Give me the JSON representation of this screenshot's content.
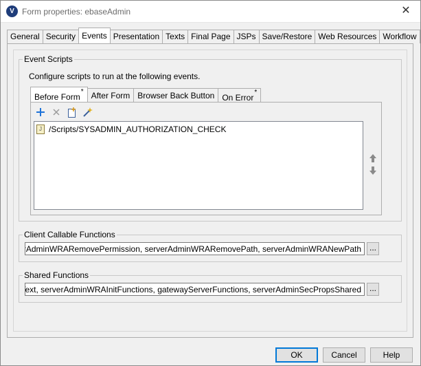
{
  "window": {
    "title": "Form properties: ebaseAdmin",
    "app_icon_letter": "V",
    "close_glyph": "✕"
  },
  "main_tabs": [
    {
      "label": "General"
    },
    {
      "label": "Security"
    },
    {
      "label": "Events",
      "active": true
    },
    {
      "label": "Presentation"
    },
    {
      "label": "Texts"
    },
    {
      "label": "Final Page"
    },
    {
      "label": "JSPs"
    },
    {
      "label": "Save/Restore"
    },
    {
      "label": "Web Resources"
    },
    {
      "label": "Workflow"
    }
  ],
  "event_scripts": {
    "group_label": "Event Scripts",
    "description": "Configure scripts to run at the following events.",
    "tabs": [
      {
        "label": "Before Form",
        "marker": "*",
        "active": true
      },
      {
        "label": "After Form",
        "marker": ""
      },
      {
        "label": "Browser Back Button",
        "marker": ""
      },
      {
        "label": "On Error",
        "marker": "*"
      }
    ],
    "toolbar_icons": [
      "add-icon",
      "delete-icon",
      "new-script-icon",
      "wizard-icon"
    ],
    "scripts": [
      {
        "name": "/Scripts/SYSADMIN_AUTHORIZATION_CHECK",
        "icon": "js-file-icon"
      }
    ],
    "move_icons": [
      "move-up-icon",
      "move-down-icon"
    ]
  },
  "client_callable": {
    "group_label": "Client Callable Functions",
    "value": "nfig, serverAdminWRARemovePermission, serverAdminWRARemovePath, serverAdminWRANewPath",
    "button_label": "..."
  },
  "shared_functions": {
    "group_label": "Shared Functions",
    "value": "PreviewText, serverAdminWRAInitFunctions, gatewayServerFunctions, serverAdminSecPropsShared",
    "button_label": "..."
  },
  "buttons": {
    "ok": "OK",
    "cancel": "Cancel",
    "help": "Help"
  },
  "colors": {
    "accent": "#0078d7",
    "add_icon": "#1e73d8"
  }
}
